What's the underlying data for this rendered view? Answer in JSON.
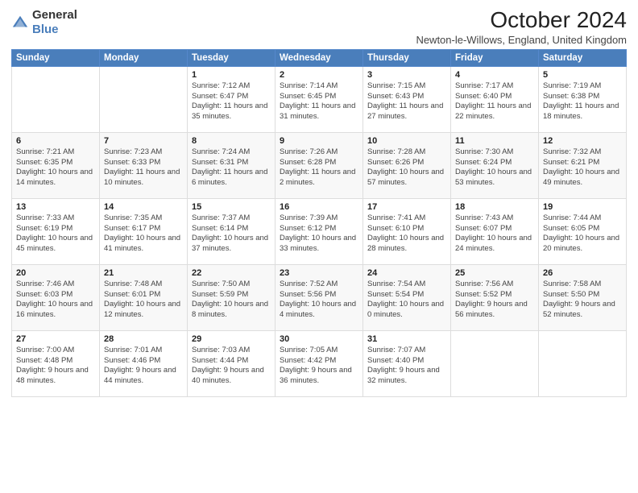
{
  "logo": {
    "general": "General",
    "blue": "Blue"
  },
  "title": "October 2024",
  "subtitle": "Newton-le-Willows, England, United Kingdom",
  "days_of_week": [
    "Sunday",
    "Monday",
    "Tuesday",
    "Wednesday",
    "Thursday",
    "Friday",
    "Saturday"
  ],
  "weeks": [
    [
      null,
      null,
      {
        "day": "1",
        "sunrise": "7:12 AM",
        "sunset": "6:47 PM",
        "daylight": "11 hours and 35 minutes."
      },
      {
        "day": "2",
        "sunrise": "7:14 AM",
        "sunset": "6:45 PM",
        "daylight": "11 hours and 31 minutes."
      },
      {
        "day": "3",
        "sunrise": "7:15 AM",
        "sunset": "6:43 PM",
        "daylight": "11 hours and 27 minutes."
      },
      {
        "day": "4",
        "sunrise": "7:17 AM",
        "sunset": "6:40 PM",
        "daylight": "11 hours and 22 minutes."
      },
      {
        "day": "5",
        "sunrise": "7:19 AM",
        "sunset": "6:38 PM",
        "daylight": "11 hours and 18 minutes."
      }
    ],
    [
      {
        "day": "6",
        "sunrise": "7:21 AM",
        "sunset": "6:35 PM",
        "daylight": "10 hours and 14 minutes."
      },
      {
        "day": "7",
        "sunrise": "7:23 AM",
        "sunset": "6:33 PM",
        "daylight": "11 hours and 10 minutes."
      },
      {
        "day": "8",
        "sunrise": "7:24 AM",
        "sunset": "6:31 PM",
        "daylight": "11 hours and 6 minutes."
      },
      {
        "day": "9",
        "sunrise": "7:26 AM",
        "sunset": "6:28 PM",
        "daylight": "11 hours and 2 minutes."
      },
      {
        "day": "10",
        "sunrise": "7:28 AM",
        "sunset": "6:26 PM",
        "daylight": "10 hours and 57 minutes."
      },
      {
        "day": "11",
        "sunrise": "7:30 AM",
        "sunset": "6:24 PM",
        "daylight": "10 hours and 53 minutes."
      },
      {
        "day": "12",
        "sunrise": "7:32 AM",
        "sunset": "6:21 PM",
        "daylight": "10 hours and 49 minutes."
      }
    ],
    [
      {
        "day": "13",
        "sunrise": "7:33 AM",
        "sunset": "6:19 PM",
        "daylight": "10 hours and 45 minutes."
      },
      {
        "day": "14",
        "sunrise": "7:35 AM",
        "sunset": "6:17 PM",
        "daylight": "10 hours and 41 minutes."
      },
      {
        "day": "15",
        "sunrise": "7:37 AM",
        "sunset": "6:14 PM",
        "daylight": "10 hours and 37 minutes."
      },
      {
        "day": "16",
        "sunrise": "7:39 AM",
        "sunset": "6:12 PM",
        "daylight": "10 hours and 33 minutes."
      },
      {
        "day": "17",
        "sunrise": "7:41 AM",
        "sunset": "6:10 PM",
        "daylight": "10 hours and 28 minutes."
      },
      {
        "day": "18",
        "sunrise": "7:43 AM",
        "sunset": "6:07 PM",
        "daylight": "10 hours and 24 minutes."
      },
      {
        "day": "19",
        "sunrise": "7:44 AM",
        "sunset": "6:05 PM",
        "daylight": "10 hours and 20 minutes."
      }
    ],
    [
      {
        "day": "20",
        "sunrise": "7:46 AM",
        "sunset": "6:03 PM",
        "daylight": "10 hours and 16 minutes."
      },
      {
        "day": "21",
        "sunrise": "7:48 AM",
        "sunset": "6:01 PM",
        "daylight": "10 hours and 12 minutes."
      },
      {
        "day": "22",
        "sunrise": "7:50 AM",
        "sunset": "5:59 PM",
        "daylight": "10 hours and 8 minutes."
      },
      {
        "day": "23",
        "sunrise": "7:52 AM",
        "sunset": "5:56 PM",
        "daylight": "10 hours and 4 minutes."
      },
      {
        "day": "24",
        "sunrise": "7:54 AM",
        "sunset": "5:54 PM",
        "daylight": "10 hours and 0 minutes."
      },
      {
        "day": "25",
        "sunrise": "7:56 AM",
        "sunset": "5:52 PM",
        "daylight": "9 hours and 56 minutes."
      },
      {
        "day": "26",
        "sunrise": "7:58 AM",
        "sunset": "5:50 PM",
        "daylight": "9 hours and 52 minutes."
      }
    ],
    [
      {
        "day": "27",
        "sunrise": "7:00 AM",
        "sunset": "4:48 PM",
        "daylight": "9 hours and 48 minutes."
      },
      {
        "day": "28",
        "sunrise": "7:01 AM",
        "sunset": "4:46 PM",
        "daylight": "9 hours and 44 minutes."
      },
      {
        "day": "29",
        "sunrise": "7:03 AM",
        "sunset": "4:44 PM",
        "daylight": "9 hours and 40 minutes."
      },
      {
        "day": "30",
        "sunrise": "7:05 AM",
        "sunset": "4:42 PM",
        "daylight": "9 hours and 36 minutes."
      },
      {
        "day": "31",
        "sunrise": "7:07 AM",
        "sunset": "4:40 PM",
        "daylight": "9 hours and 32 minutes."
      },
      null,
      null
    ]
  ]
}
